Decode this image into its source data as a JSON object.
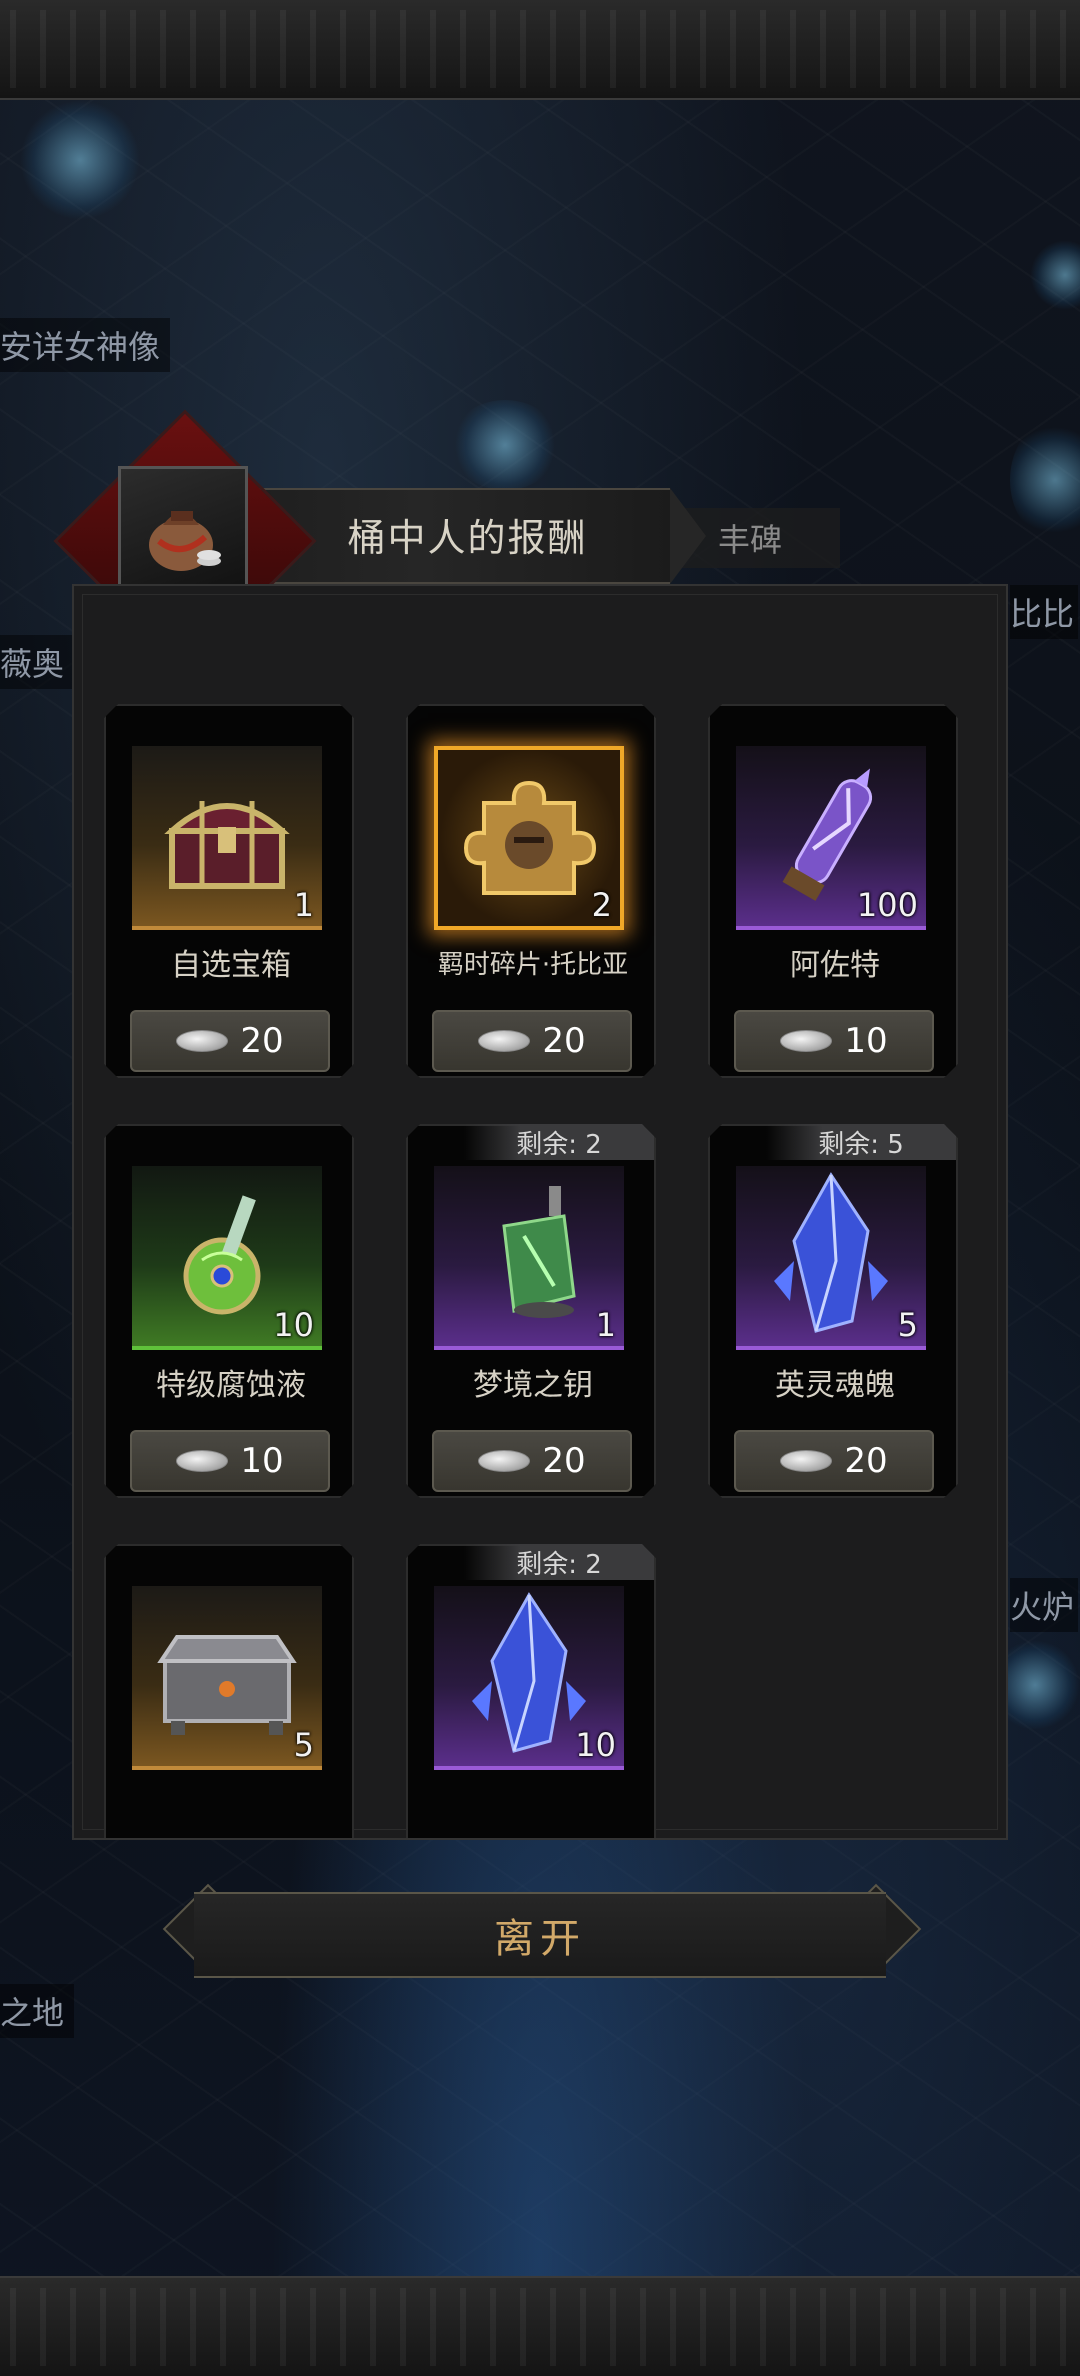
{
  "map_labels": [
    {
      "text": "安详女神像"
    },
    {
      "text": "薇奥"
    },
    {
      "text": "比比"
    },
    {
      "text": "火炉"
    },
    {
      "text": "之地"
    }
  ],
  "dialog": {
    "title": "桶中人的报酬",
    "side_tab": "丰碑",
    "avatar_icon": "coin-bag-icon",
    "leave_label": "离开"
  },
  "currency_icon": "silver-coin-icon",
  "items": [
    {
      "name": "自选宝箱",
      "qty": "1",
      "price": "20",
      "rarity": "gold",
      "icon": "treasure-chest-icon",
      "remaining": ""
    },
    {
      "name": "羁时碎片·托比亚",
      "qty": "2",
      "price": "20",
      "rarity": "legend",
      "icon": "puzzle-piece-icon",
      "remaining": ""
    },
    {
      "name": "阿佐特",
      "qty": "100",
      "price": "10",
      "rarity": "purple",
      "icon": "crystal-vial-icon",
      "remaining": ""
    },
    {
      "name": "特级腐蚀液",
      "qty": "10",
      "price": "10",
      "rarity": "green",
      "icon": "potion-flask-icon",
      "remaining": ""
    },
    {
      "name": "梦境之钥",
      "qty": "1",
      "price": "20",
      "rarity": "purple",
      "icon": "lantern-key-icon",
      "remaining": "剩余: 2"
    },
    {
      "name": "英灵魂魄",
      "qty": "5",
      "price": "20",
      "rarity": "purple",
      "icon": "blue-crystal-icon",
      "remaining": "剩余: 5"
    },
    {
      "name": "",
      "qty": "5",
      "price": "",
      "rarity": "gold",
      "icon": "silver-chest-icon",
      "remaining": ""
    },
    {
      "name": "",
      "qty": "10",
      "price": "",
      "rarity": "purple",
      "icon": "blue-crystal-icon",
      "remaining": "剩余: 2"
    }
  ],
  "colors": {
    "gold": "#c18a3a",
    "purple": "#9a5ad8",
    "green": "#5fc23a",
    "legend": "#f0a828",
    "leave_text": "#d2a969"
  }
}
